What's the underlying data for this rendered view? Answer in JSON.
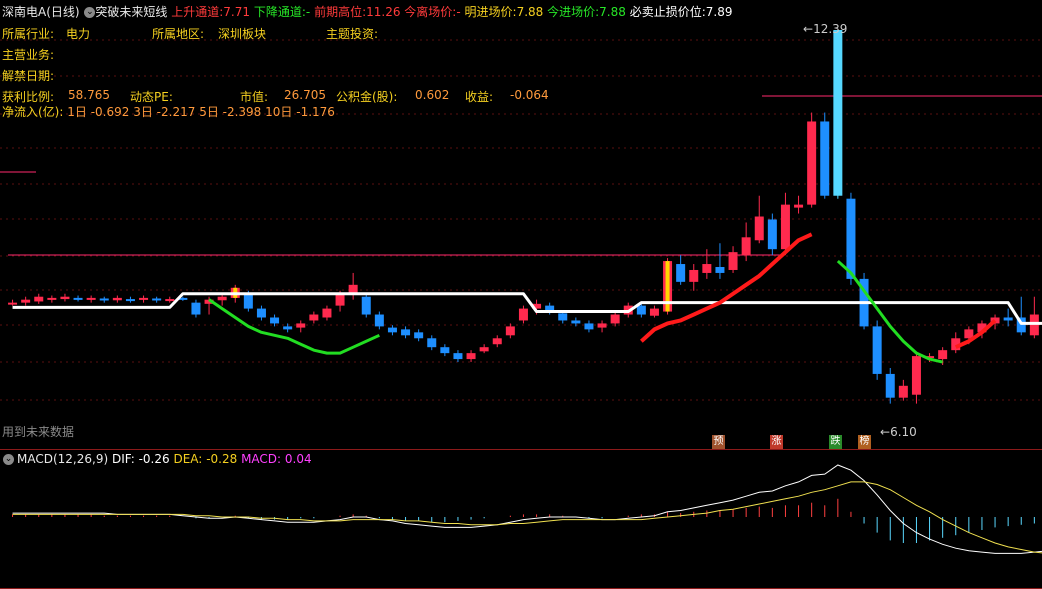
{
  "header": {
    "stock_name": "深南电A(日线)",
    "indicator_name": "突破未来短线",
    "up_channel_label": "上升通道:",
    "up_channel_value": "7.71",
    "down_channel_label": "下降通道:",
    "down_channel_value": "-",
    "prev_high_label": "前期高位:",
    "prev_high_value": "11.26",
    "today_exit_label": "今离场价:",
    "today_exit_value": "-",
    "tomorrow_entry_label": "明进场价:",
    "tomorrow_entry_value": "7.88",
    "today_entry_label": "今进场价:",
    "today_entry_value": "7.88",
    "stop_loss_label": "必卖止损价位:",
    "stop_loss_value": "7.89"
  },
  "info": {
    "industry_label": "所属行业:",
    "industry_value": "电力",
    "region_label": "所属地区:",
    "region_value": "深圳板块",
    "theme_label": "主题投资:",
    "business_label": "主营业务:",
    "unlock_label": "解禁日期:",
    "profit_ratio_label": "获利比例:",
    "profit_ratio_value": "58.765",
    "pe_label": "动态PE:",
    "mcap_label": "市值:",
    "mcap_value": "26.705",
    "reserve_label": "公积金(股):",
    "reserve_value": "0.602",
    "eps_label": "收益:",
    "eps_value": "-0.064",
    "inflow_label": "净流入(亿):",
    "inflow_1d": "1日 -0.692",
    "inflow_3d": "3日 -2.217",
    "inflow_5d": "5日 -2.398",
    "inflow_10d": "10日 -1.176"
  },
  "footer_note": "用到未来数据",
  "signals": [
    "预",
    "涨",
    "跌",
    "榜"
  ],
  "price_labels": {
    "high": "12.39",
    "low": "6.10"
  },
  "macd": {
    "title": "MACD(12,26,9)",
    "dif_label": "DIF:",
    "dif_value": "-0.26",
    "dea_label": "DEA:",
    "dea_value": "-0.28",
    "macd_label": "MACD:",
    "macd_value": "0.04"
  },
  "colors": {
    "up": "#ff2a4e",
    "down": "#1e8fff",
    "up_channel": "#ff1a1a",
    "down_channel": "#22dd22",
    "resistance": "#ffffff",
    "dif": "#ffffff",
    "dea": "#f0e050"
  },
  "chart_data": {
    "type": "candlestick",
    "candles": [
      [
        7.8,
        7.8,
        7.75,
        7.85
      ],
      [
        7.8,
        7.85,
        7.75,
        7.9
      ],
      [
        7.82,
        7.9,
        7.78,
        7.95
      ],
      [
        7.85,
        7.88,
        7.8,
        7.92
      ],
      [
        7.86,
        7.9,
        7.82,
        7.95
      ],
      [
        7.88,
        7.86,
        7.82,
        7.92
      ],
      [
        7.85,
        7.88,
        7.8,
        7.92
      ],
      [
        7.87,
        7.84,
        7.8,
        7.9
      ],
      [
        7.84,
        7.88,
        7.8,
        7.92
      ],
      [
        7.86,
        7.84,
        7.8,
        7.9
      ],
      [
        7.85,
        7.88,
        7.8,
        7.92
      ],
      [
        7.87,
        7.85,
        7.8,
        7.9
      ],
      [
        7.84,
        7.86,
        7.8,
        7.9
      ],
      [
        7.88,
        7.87,
        7.83,
        7.9
      ],
      [
        7.8,
        7.6,
        7.55,
        7.85
      ],
      [
        7.78,
        7.85,
        7.6,
        7.9
      ],
      [
        7.84,
        7.9,
        7.75,
        7.95
      ],
      [
        7.88,
        8.05,
        7.8,
        8.1
      ],
      [
        7.95,
        7.7,
        7.65,
        8.0
      ],
      [
        7.7,
        7.55,
        7.5,
        7.75
      ],
      [
        7.55,
        7.45,
        7.4,
        7.6
      ],
      [
        7.4,
        7.35,
        7.3,
        7.45
      ],
      [
        7.38,
        7.45,
        7.3,
        7.5
      ],
      [
        7.5,
        7.6,
        7.45,
        7.65
      ],
      [
        7.55,
        7.7,
        7.5,
        7.75
      ],
      [
        7.75,
        7.95,
        7.65,
        8.0
      ],
      [
        7.95,
        8.1,
        7.85,
        8.3
      ],
      [
        7.9,
        7.6,
        7.55,
        7.95
      ],
      [
        7.6,
        7.4,
        7.35,
        7.65
      ],
      [
        7.38,
        7.3,
        7.25,
        7.42
      ],
      [
        7.35,
        7.25,
        7.2,
        7.4
      ],
      [
        7.3,
        7.2,
        7.15,
        7.35
      ],
      [
        7.2,
        7.05,
        7.0,
        7.25
      ],
      [
        7.05,
        6.95,
        6.9,
        7.1
      ],
      [
        6.95,
        6.85,
        6.8,
        7.0
      ],
      [
        6.85,
        6.95,
        6.8,
        7.0
      ],
      [
        6.98,
        7.05,
        6.95,
        7.1
      ],
      [
        7.1,
        7.2,
        7.05,
        7.25
      ],
      [
        7.25,
        7.4,
        7.2,
        7.45
      ],
      [
        7.5,
        7.7,
        7.45,
        7.75
      ],
      [
        7.7,
        7.78,
        7.6,
        7.85
      ],
      [
        7.75,
        7.65,
        7.6,
        7.8
      ],
      [
        7.62,
        7.5,
        7.45,
        7.65
      ],
      [
        7.5,
        7.45,
        7.4,
        7.55
      ],
      [
        7.45,
        7.35,
        7.3,
        7.5
      ],
      [
        7.38,
        7.45,
        7.3,
        7.5
      ],
      [
        7.45,
        7.6,
        7.4,
        7.65
      ],
      [
        7.6,
        7.75,
        7.55,
        7.8
      ],
      [
        7.75,
        7.6,
        7.55,
        7.8
      ],
      [
        7.58,
        7.7,
        7.55,
        7.75
      ],
      [
        7.65,
        8.5,
        7.6,
        8.55
      ],
      [
        8.45,
        8.15,
        8.1,
        8.6
      ],
      [
        8.15,
        8.35,
        8.0,
        8.45
      ],
      [
        8.3,
        8.45,
        8.2,
        8.7
      ],
      [
        8.4,
        8.3,
        8.2,
        8.8
      ],
      [
        8.35,
        8.65,
        8.3,
        8.75
      ],
      [
        8.6,
        8.9,
        8.5,
        9.15
      ],
      [
        8.85,
        9.25,
        8.8,
        9.6
      ],
      [
        9.2,
        8.7,
        8.6,
        9.3
      ],
      [
        8.7,
        9.45,
        8.6,
        9.65
      ],
      [
        9.4,
        9.45,
        9.3,
        9.6
      ],
      [
        9.45,
        10.85,
        9.4,
        11.0
      ],
      [
        10.85,
        9.6,
        9.55,
        11.0
      ],
      [
        9.6,
        12.39,
        9.55,
        12.39
      ],
      [
        9.55,
        8.2,
        8.1,
        9.65
      ],
      [
        8.2,
        7.4,
        7.35,
        8.3
      ],
      [
        7.4,
        6.6,
        6.5,
        7.5
      ],
      [
        6.6,
        6.2,
        6.1,
        6.7
      ],
      [
        6.2,
        6.4,
        6.15,
        6.5
      ],
      [
        6.25,
        6.9,
        6.1,
        6.95
      ],
      [
        6.9,
        6.9,
        6.8,
        6.95
      ],
      [
        6.85,
        7.0,
        6.75,
        7.05
      ],
      [
        7.0,
        7.2,
        6.95,
        7.3
      ],
      [
        7.2,
        7.35,
        7.1,
        7.4
      ],
      [
        7.3,
        7.45,
        7.2,
        7.5
      ],
      [
        7.45,
        7.55,
        7.35,
        7.6
      ],
      [
        7.55,
        7.5,
        7.4,
        7.7
      ],
      [
        7.55,
        7.3,
        7.25,
        7.9
      ],
      [
        7.25,
        7.6,
        7.2,
        7.9
      ],
      [
        7.55,
        7.55,
        7.45,
        7.7
      ]
    ],
    "up_channel_line": [
      7.15,
      7.35,
      7.45,
      7.5,
      7.6,
      7.7,
      7.8,
      7.95,
      8.1,
      8.25,
      8.45,
      8.65,
      8.85,
      8.95,
      7.05,
      7.15,
      7.3,
      7.5
    ],
    "down_channel_line": [
      8.5,
      8.3,
      8.0,
      7.7,
      7.4,
      7.15,
      6.95,
      6.85,
      6.8
    ],
    "resistance_line": [
      7.72,
      7.72,
      7.72,
      7.72,
      7.72,
      7.72,
      7.72,
      7.72,
      7.72,
      7.72,
      7.72,
      7.72,
      7.72,
      7.95,
      7.95,
      7.95,
      7.95,
      7.95,
      7.95,
      7.95,
      7.95,
      7.95,
      7.95,
      7.95,
      7.95,
      7.95,
      7.95,
      7.95,
      7.95,
      7.95,
      7.95,
      7.95,
      7.95,
      7.95,
      7.95,
      7.95,
      7.95,
      7.95,
      7.95,
      7.95,
      7.65,
      7.65,
      7.65,
      7.65,
      7.65,
      7.65,
      7.65,
      7.65,
      7.8,
      7.8,
      7.8,
      7.8,
      7.8,
      7.8,
      7.8,
      7.8,
      7.8,
      7.8,
      7.8,
      7.8,
      7.8,
      7.8,
      7.8,
      7.8,
      7.8,
      7.8,
      7.8,
      7.8,
      7.8,
      7.8,
      7.8,
      7.8,
      7.8,
      7.8,
      7.8,
      7.8,
      7.8,
      7.45,
      7.45,
      7.45
    ],
    "macd_hist": [
      0.02,
      0.02,
      0.02,
      0.02,
      0.02,
      0.02,
      0.02,
      0.01,
      0.01,
      0.01,
      0.01,
      0.01,
      0.01,
      0.0,
      -0.01,
      -0.01,
      0.0,
      0.01,
      -0.01,
      -0.02,
      -0.02,
      -0.02,
      -0.01,
      -0.01,
      0.0,
      0.01,
      0.02,
      0.01,
      -0.01,
      -0.02,
      -0.03,
      -0.03,
      -0.04,
      -0.04,
      -0.03,
      -0.02,
      -0.01,
      0.0,
      0.01,
      0.02,
      0.02,
      0.02,
      0.01,
      0.0,
      -0.01,
      -0.01,
      0.0,
      0.01,
      0.02,
      0.02,
      0.04,
      0.03,
      0.04,
      0.05,
      0.05,
      0.06,
      0.07,
      0.08,
      0.07,
      0.09,
      0.09,
      0.11,
      0.09,
      0.14,
      0.04,
      -0.05,
      -0.12,
      -0.18,
      -0.2,
      -0.2,
      -0.18,
      -0.16,
      -0.14,
      -0.12,
      -0.1,
      -0.08,
      -0.07,
      -0.06,
      -0.05,
      0.04
    ],
    "dif_line": [
      0.03,
      0.03,
      0.03,
      0.03,
      0.03,
      0.03,
      0.03,
      0.03,
      0.02,
      0.02,
      0.02,
      0.02,
      0.02,
      0.01,
      0.0,
      -0.01,
      -0.01,
      0.0,
      -0.01,
      -0.02,
      -0.03,
      -0.04,
      -0.04,
      -0.04,
      -0.03,
      -0.02,
      0.0,
      0.0,
      -0.02,
      -0.03,
      -0.05,
      -0.06,
      -0.07,
      -0.08,
      -0.08,
      -0.08,
      -0.07,
      -0.06,
      -0.04,
      -0.02,
      -0.01,
      0.0,
      0.0,
      0.0,
      -0.01,
      -0.02,
      -0.02,
      -0.01,
      0.0,
      0.01,
      0.04,
      0.05,
      0.07,
      0.09,
      0.11,
      0.13,
      0.16,
      0.19,
      0.2,
      0.24,
      0.27,
      0.32,
      0.33,
      0.4,
      0.36,
      0.28,
      0.17,
      0.05,
      -0.05,
      -0.12,
      -0.17,
      -0.21,
      -0.24,
      -0.26,
      -0.27,
      -0.28,
      -0.28,
      -0.28,
      -0.27,
      -0.26
    ],
    "dea_line": [
      0.02,
      0.02,
      0.02,
      0.02,
      0.02,
      0.02,
      0.02,
      0.02,
      0.02,
      0.02,
      0.02,
      0.02,
      0.02,
      0.02,
      0.01,
      0.01,
      0.0,
      0.0,
      0.0,
      -0.01,
      -0.01,
      -0.02,
      -0.02,
      -0.03,
      -0.03,
      -0.03,
      -0.02,
      -0.02,
      -0.02,
      -0.02,
      -0.03,
      -0.03,
      -0.04,
      -0.05,
      -0.05,
      -0.06,
      -0.06,
      -0.06,
      -0.05,
      -0.05,
      -0.04,
      -0.03,
      -0.02,
      -0.02,
      -0.02,
      -0.02,
      -0.02,
      -0.02,
      -0.02,
      -0.01,
      0.0,
      0.01,
      0.02,
      0.03,
      0.05,
      0.06,
      0.08,
      0.1,
      0.12,
      0.14,
      0.16,
      0.19,
      0.21,
      0.24,
      0.27,
      0.27,
      0.25,
      0.21,
      0.15,
      0.09,
      0.04,
      -0.02,
      -0.07,
      -0.12,
      -0.16,
      -0.2,
      -0.23,
      -0.25,
      -0.27,
      -0.28
    ]
  }
}
